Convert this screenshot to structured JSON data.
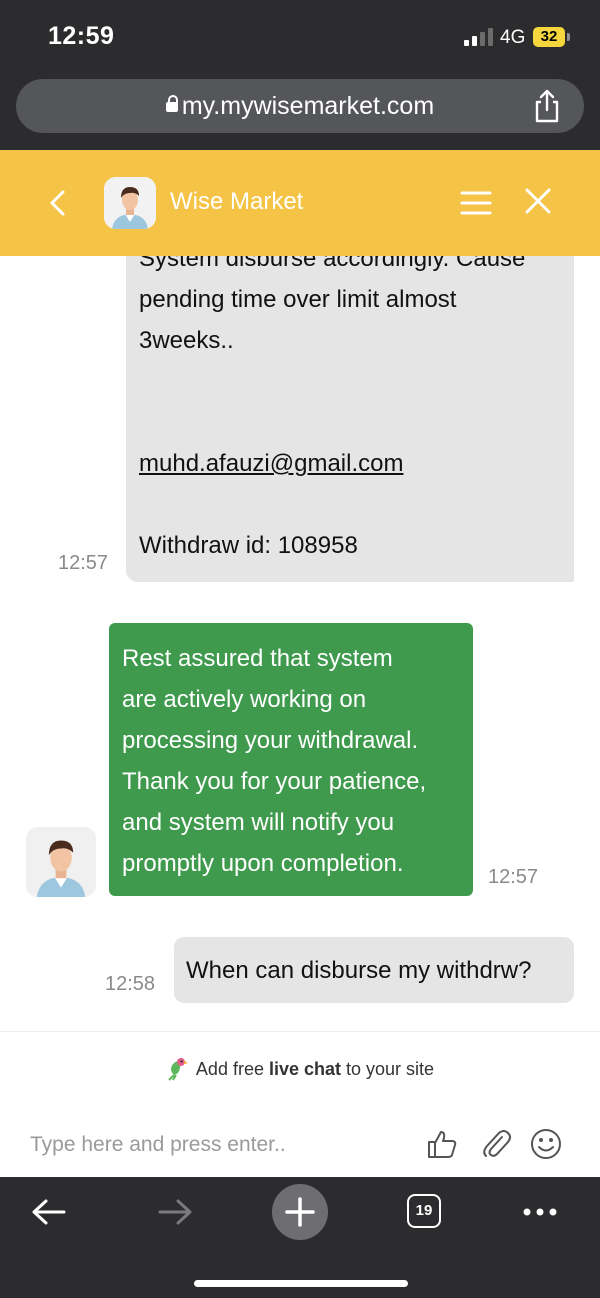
{
  "status_bar": {
    "time": "12:59",
    "network": "4G",
    "battery": "32"
  },
  "browser": {
    "url": "my.mywisemarket.com",
    "tab_count": "19"
  },
  "chat": {
    "agent_name": "Wise Market",
    "messages": {
      "m1": {
        "line1": "System disburse accordingly. Cause",
        "line2": "pending time over limit almost",
        "line3": "3weeks..",
        "email": "muhd.afauzi@gmail.com",
        "withdraw": "Withdraw id: 108958",
        "time": "12:57"
      },
      "m2": {
        "line1": "Rest assured that system",
        "line2": "are actively working on",
        "line3": "processing your withdrawal.",
        "line4": "Thank you for your patience,",
        "line5": "and system will notify you",
        "line6": "promptly upon completion.",
        "time": "12:57"
      },
      "m3": {
        "text": "When can disburse my withdrw?",
        "time": "12:58"
      }
    },
    "promo": {
      "prefix": "Add free ",
      "bold": "live chat",
      "suffix": " to your site"
    },
    "input": {
      "placeholder": "Type here and press enter.."
    }
  },
  "colors": {
    "header": "#f5c346",
    "agent_bubble": "#3f9a4d",
    "visitor_bubble": "#e5e5e5"
  },
  "icons": [
    "lock-icon",
    "share-icon",
    "back-chevron-icon",
    "menu-icon",
    "close-icon",
    "parrot-icon",
    "thumbs-up-icon",
    "paperclip-icon",
    "smiley-icon",
    "back-arrow-icon",
    "forward-arrow-icon",
    "plus-icon",
    "more-icon"
  ]
}
